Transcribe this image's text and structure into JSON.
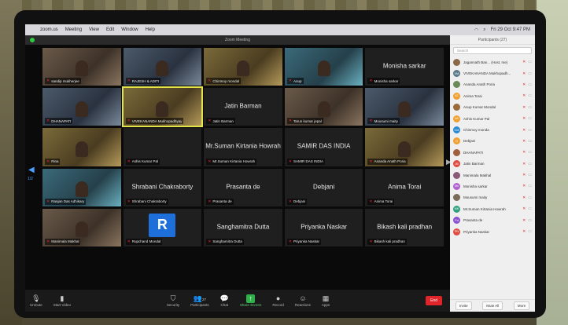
{
  "menubar": {
    "app": "zoom.us",
    "items": [
      "Meeting",
      "View",
      "Edit",
      "Window",
      "Help"
    ],
    "clock": "Fri 29 Oct 9:47 PM"
  },
  "window_title": "Zoom Meeting",
  "gallery": {
    "page_number": "1/2",
    "tiles": [
      {
        "label": "sandip mukherjee",
        "name_text": "",
        "kind": "video"
      },
      {
        "label": "RAJESH & ADITI",
        "name_text": "",
        "kind": "video"
      },
      {
        "label": "Chinmoy mondal",
        "name_text": "",
        "kind": "video"
      },
      {
        "label": "Anup",
        "name_text": "",
        "kind": "video"
      },
      {
        "label": "Monisha sarkar",
        "name_text": "Monisha sarkar",
        "kind": "name"
      },
      {
        "label": "DHANAPATI",
        "name_text": "",
        "kind": "video"
      },
      {
        "label": "VIVEKANANDA Mukhopadhyay",
        "name_text": "",
        "kind": "video"
      },
      {
        "label": "Jatin Barman",
        "name_text": "Jatin Barman",
        "kind": "name"
      },
      {
        "label": "Tarun kumar jepal",
        "name_text": "",
        "kind": "video"
      },
      {
        "label": "Mousumi maity",
        "name_text": "",
        "kind": "video"
      },
      {
        "label": "Rina",
        "name_text": "",
        "kind": "video"
      },
      {
        "label": "Ashis Kumar Pal",
        "name_text": "",
        "kind": "dark"
      },
      {
        "label": "Mr.Suman Kirtania Howrah",
        "name_text": "Mr.Suman Kirtania Howrah",
        "kind": "name"
      },
      {
        "label": "SAMIR DAS INDIA",
        "name_text": "SAMIR DAS INDIA",
        "kind": "name"
      },
      {
        "label": "Ananda Anath Poria",
        "name_text": "",
        "kind": "video"
      },
      {
        "label": "Ranjan Das Adhikary",
        "name_text": "",
        "kind": "video"
      },
      {
        "label": "Shrabani Chakraborty",
        "name_text": "Shrabani Chakraborty",
        "kind": "name"
      },
      {
        "label": "Prasanta de",
        "name_text": "Prasanta de",
        "kind": "name"
      },
      {
        "label": "Debjani",
        "name_text": "Debjani",
        "kind": "name"
      },
      {
        "label": "Anima Torai",
        "name_text": "Anima Torai",
        "kind": "name"
      },
      {
        "label": "Manimala Makhal",
        "name_text": "",
        "kind": "video"
      },
      {
        "label": "Rupchand Mondal",
        "name_text": "R",
        "kind": "avatar"
      },
      {
        "label": "Sanghamitra Dutta",
        "name_text": "Sanghamitra Dutta",
        "kind": "name"
      },
      {
        "label": "Priyanka Naskar",
        "name_text": "Priyanka Naskar",
        "kind": "name"
      },
      {
        "label": "Bikash kali pradhan",
        "name_text": "Bikash kali pradhan",
        "kind": "name"
      }
    ]
  },
  "toolbar": {
    "unmute": "Unmute",
    "start_video": "Start Video",
    "security": "Security",
    "participants": "Participants",
    "participants_count": "27",
    "chat": "Chat",
    "share_screen": "Share Screen",
    "record": "Record",
    "reactions": "Reactions",
    "apps": "Apps",
    "end": "End"
  },
  "panel": {
    "title": "Participants (27)",
    "search_placeholder": "Search",
    "participants": [
      {
        "name": "Jagannath Ban... (Host, me)",
        "initials": "",
        "color": "#8a6a4a"
      },
      {
        "name": "VIVEKANANDA Mukhopadh...",
        "initials": "VM",
        "color": "#5a7a8a"
      },
      {
        "name": "Ananda Anath Poria",
        "initials": "",
        "color": "#6a8a5a"
      },
      {
        "name": "Anima Torai",
        "initials": "AT",
        "color": "#f0a030"
      },
      {
        "name": "Anup Kumar Mondal",
        "initials": "",
        "color": "#9a6a3a"
      },
      {
        "name": "Ashis Kumar Pal",
        "initials": "AK",
        "color": "#f0a030"
      },
      {
        "name": "Chinmoy monda",
        "initials": "CM",
        "color": "#2a8ad0"
      },
      {
        "name": "Debjani",
        "initials": "D",
        "color": "#f0a030"
      },
      {
        "name": "DHANAPATI",
        "initials": "",
        "color": "#a06040"
      },
      {
        "name": "Jatin Barman",
        "initials": "JB",
        "color": "#e04a40"
      },
      {
        "name": "Manimala Makhal",
        "initials": "",
        "color": "#8a5a7a"
      },
      {
        "name": "Monisha sarkar",
        "initials": "Ms",
        "color": "#b060d0"
      },
      {
        "name": "Mousumi maity",
        "initials": "",
        "color": "#7a6a5a"
      },
      {
        "name": "Mr.Suman Kirtania Howrah",
        "initials": "MK",
        "color": "#30a080"
      },
      {
        "name": "Prasanta de",
        "initials": "Pd",
        "color": "#8a50d0"
      },
      {
        "name": "Priyanka Naskar",
        "initials": "PN",
        "color": "#e04a40"
      }
    ],
    "invite": "Invite",
    "mute_all": "Mute All",
    "more": "More"
  }
}
